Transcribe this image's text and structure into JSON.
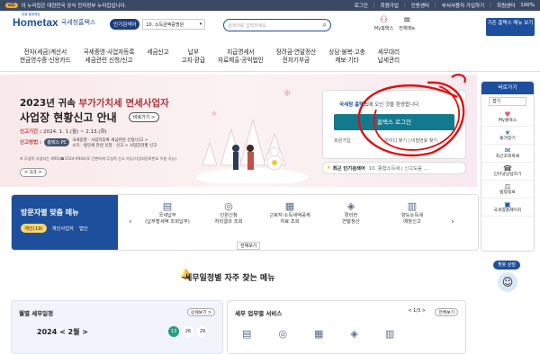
{
  "topbar": {
    "badge": "eG",
    "notice": "이 누리집은 대한민국 공식 전자정부 누리집입니다.",
    "links": [
      "로그인",
      "회원가입",
      "인증센터",
      "부서사용자 가입하기",
      "회원센터"
    ],
    "zoom": "100%"
  },
  "header": {
    "logo": "Hometax",
    "logo_sub": "국세청홈택스",
    "logo_tag": "믿음 통합제공",
    "keyword_label": "인기검색어",
    "keyword_value": "10. 소득금액증명원",
    "search_placeholder": "검색어를 입력하세요.",
    "icons": [
      {
        "label": "My홈택스",
        "icon": "user-icon"
      },
      {
        "label": "전체메뉴",
        "icon": "menu-icon"
      }
    ],
    "enterprise_btn": "기존 홈택스 메뉴 보기"
  },
  "nav": [
    "전자(세금)계산서\n현금영수증·신용카드",
    "국세증명·사업자등록\n세금관련 신청/신고",
    "세금신고",
    "납부\n고지·환급",
    "지급명세서\n자료제출·공익법인",
    "장려금·연말정산\n전자기부금",
    "상담·불복·고충\n제보·기타",
    "세무대리\n납세관리"
  ],
  "hero": {
    "line1_a": "2023년 귀속 ",
    "line1_hl": "부가가치세 면세사업자",
    "line2": "사업장 현황신고 안내",
    "more": "바로가기 >",
    "deadline_label": "신고기간 :",
    "deadline": "2024. 1. 1.(월) ~ 2.13.(화)",
    "method_label": "신고방법 :",
    "method_pill": "홈택스 PC",
    "method_path": "국세증명 · 사업자등록 세금관련 신청/신고 >\n소득 · 법인세 관련 신청 · 신고 > 사업장현황 신고",
    "note": "※ 무실적 사업자는 ARS(☎1544-9944)로 간편하게 무실적 신고 가능(사업자등록번호 이용 가능)",
    "pager": "< 1/1 >"
  },
  "login": {
    "welcome_a": "국세청 홈택스",
    "welcome_b": "에 오신 것을 환영합니다.",
    "button": "홈택스 로그인",
    "sub_left": "회원가입",
    "sub_right": "아이디 찾기 | 비밀번호 찾기"
  },
  "popular": {
    "label": "최근 인기검색어",
    "content": "10. 종합소득세 | 신고도움 ..."
  },
  "side": {
    "title": "바로가기",
    "select": "접기",
    "items": [
      {
        "icon": "♥",
        "label": "My홈택스"
      },
      {
        "icon": "★",
        "label": "즐겨찾기"
      },
      {
        "icon": "✉",
        "label": "최근조회목록"
      },
      {
        "icon": "☎",
        "label": "인터넷상담하기"
      },
      {
        "icon": "⚖",
        "label": "법령정보"
      },
      {
        "icon": "▣",
        "label": "국세청홈페이지"
      }
    ]
  },
  "chat": {
    "label": "챗봇 상담"
  },
  "visit": {
    "title": "방문자별 맞춤 메뉴",
    "tabs": [
      "개인(19)",
      "개인사업자",
      "법인"
    ],
    "services": [
      {
        "icon": "▤",
        "label": "국세납부\n(납부할세액 조회납부)"
      },
      {
        "icon": "◎",
        "label": "인원신청\n처리결과 조회"
      },
      {
        "icon": "▦",
        "label": "근로자·소득세액공제\n자료 조회"
      },
      {
        "icon": "◈",
        "label": "편리한\n연말정산"
      },
      {
        "icon": "▥",
        "label": "양도소득세\n예정신고"
      }
    ],
    "view_all": "전체보기"
  },
  "schedule": {
    "title": "세무일정별 자주 찾는 메뉴",
    "monthly_title": "월별 세무일정",
    "monthly_more": "상세보기 >",
    "year": "2024",
    "month": "< 2월 >",
    "days": [
      "13",
      "26",
      "29"
    ],
    "biz_title": "세무 업무별 서비스",
    "biz_page": "< 1/3 >",
    "biz_more": "전체보기"
  }
}
